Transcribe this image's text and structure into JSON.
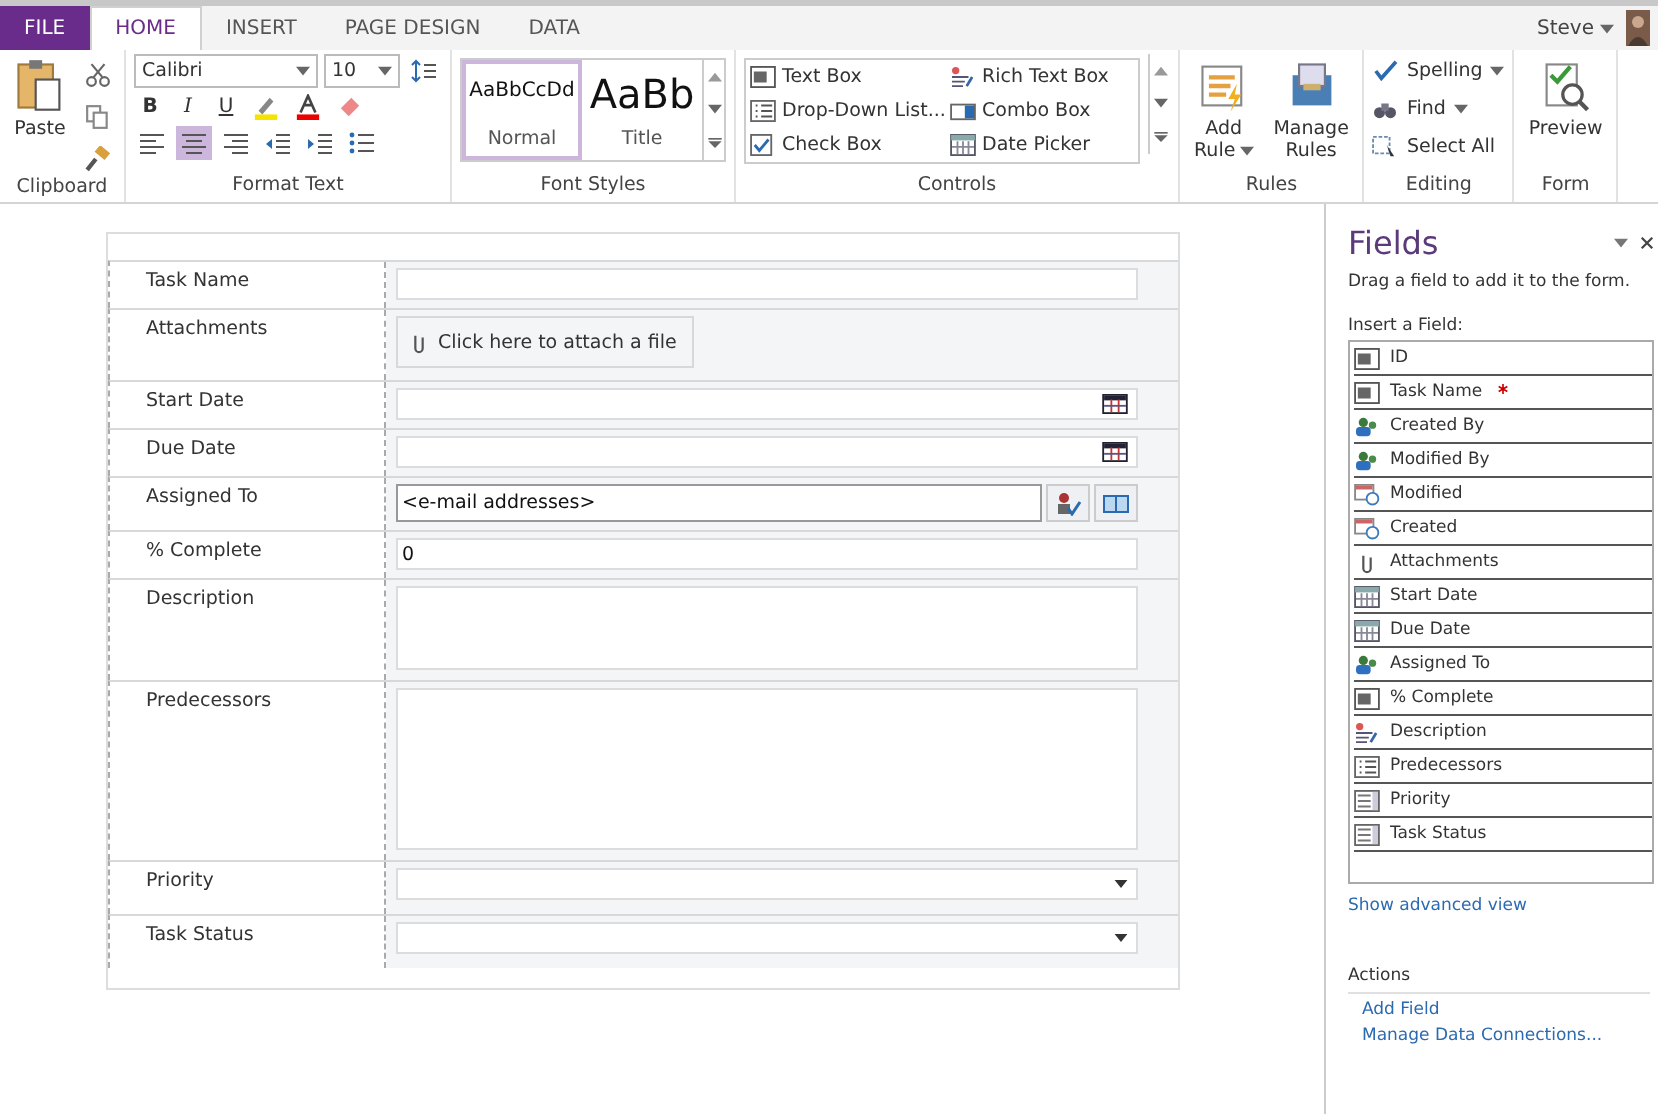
{
  "tabs": [
    {
      "label": "FILE",
      "kind": "file",
      "selected": false
    },
    {
      "label": "HOME",
      "kind": "tab",
      "selected": true
    },
    {
      "label": "INSERT",
      "kind": "tab",
      "selected": false
    },
    {
      "label": "PAGE DESIGN",
      "kind": "tab",
      "selected": false
    },
    {
      "label": "DATA",
      "kind": "tab",
      "selected": false
    }
  ],
  "user": {
    "name": "Steve"
  },
  "ribbon": {
    "clipboard": {
      "paste": "Paste",
      "label": "Clipboard"
    },
    "format_text": {
      "font": "Calibri",
      "size": "10",
      "bold": "B",
      "italic": "I",
      "underline": "U",
      "label": "Format Text"
    },
    "font_styles": {
      "styles": [
        {
          "sample": "AaBbCcDd",
          "name": "Normal",
          "selected": true
        },
        {
          "sample": "AaBb",
          "name": "Title",
          "selected": false
        }
      ],
      "label": "Font Styles"
    },
    "controls": {
      "items": [
        {
          "label": "Text Box",
          "kind": "text"
        },
        {
          "label": "Drop-Down List...",
          "kind": "list"
        },
        {
          "label": "Check Box",
          "kind": "check"
        },
        {
          "label": "Rich Text Box",
          "kind": "rich"
        },
        {
          "label": "Combo Box",
          "kind": "combo"
        },
        {
          "label": "Date Picker",
          "kind": "date"
        }
      ],
      "label": "Controls"
    },
    "rules": {
      "add": "Add",
      "add2": "Rule",
      "manage": "Manage",
      "manage2": "Rules",
      "label": "Rules"
    },
    "editing": {
      "spelling": "Spelling",
      "find": "Find",
      "select_all": "Select All",
      "label": "Editing"
    },
    "form": {
      "preview": "Preview",
      "label": "Form"
    }
  },
  "form": {
    "rows": [
      {
        "label": "Task Name",
        "kind": "text"
      },
      {
        "label": "Attachments",
        "kind": "attach",
        "value": "Click here to attach a file"
      },
      {
        "label": "Start Date",
        "kind": "date"
      },
      {
        "label": "Due Date",
        "kind": "date"
      },
      {
        "label": "Assigned To",
        "kind": "people",
        "value": "<e-mail addresses>"
      },
      {
        "label": "% Complete",
        "kind": "text",
        "value": "0"
      },
      {
        "label": "Description",
        "kind": "multiline"
      },
      {
        "label": "Predecessors",
        "kind": "lookup"
      },
      {
        "label": "Priority",
        "kind": "dropdown"
      },
      {
        "label": "Task Status",
        "kind": "dropdown"
      }
    ]
  },
  "fields_pane": {
    "title": "Fields",
    "hint": "Drag a field to add it to the form.",
    "insert_label": "Insert a Field:",
    "fields": [
      {
        "label": "ID",
        "kind": "text",
        "required": false
      },
      {
        "label": "Task Name",
        "kind": "text",
        "required": true
      },
      {
        "label": "Created By",
        "kind": "people",
        "required": false
      },
      {
        "label": "Modified By",
        "kind": "people",
        "required": false
      },
      {
        "label": "Modified",
        "kind": "datetime",
        "required": false
      },
      {
        "label": "Created",
        "kind": "datetime",
        "required": false
      },
      {
        "label": "Attachments",
        "kind": "attach",
        "required": false
      },
      {
        "label": "Start Date",
        "kind": "date",
        "required": false
      },
      {
        "label": "Due Date",
        "kind": "date",
        "required": false
      },
      {
        "label": "Assigned To",
        "kind": "people",
        "required": false
      },
      {
        "label": "% Complete",
        "kind": "text",
        "required": false
      },
      {
        "label": "Description",
        "kind": "rich",
        "required": false
      },
      {
        "label": "Predecessors",
        "kind": "list",
        "required": false
      },
      {
        "label": "Priority",
        "kind": "choice",
        "required": false
      },
      {
        "label": "Task Status",
        "kind": "choice",
        "required": false
      }
    ],
    "advanced_link": "Show advanced view",
    "actions_label": "Actions",
    "actions": [
      "Add Field",
      "Manage Data Connections..."
    ]
  }
}
